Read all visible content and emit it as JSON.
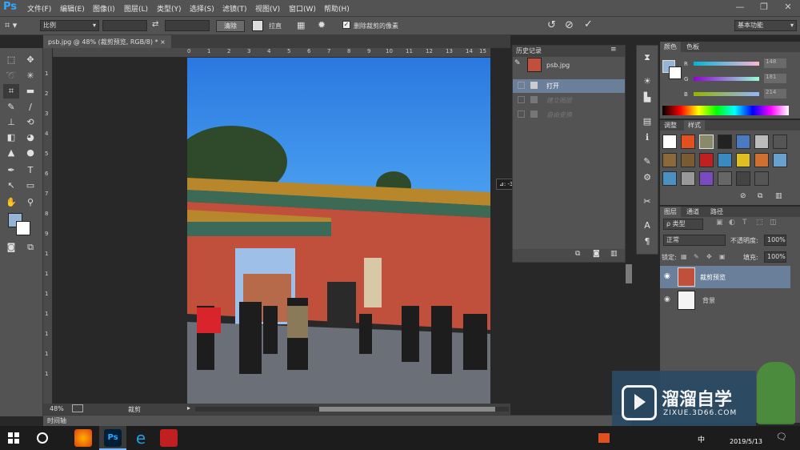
{
  "app": {
    "logo": "Ps"
  },
  "menu": [
    "文件(F)",
    "编辑(E)",
    "图像(I)",
    "图层(L)",
    "类型(Y)",
    "选择(S)",
    "滤镜(T)",
    "视图(V)",
    "窗口(W)",
    "帮助(H)"
  ],
  "window_controls": {
    "minimize": "—",
    "restore": "❐",
    "close": "✕"
  },
  "options": {
    "ratio_select": "比例",
    "swap_icon": "⇄",
    "clear_button": "清除",
    "straighten_label": "拉直",
    "delete_cropped_label": "删除裁剪的像素",
    "delete_cropped_checked": true,
    "workspace": "基本功能"
  },
  "document": {
    "tab_title": "psb.jpg @ 48% (裁剪预览, RGB/8) *",
    "tab_close": "×",
    "zoom": "48%",
    "status_tool": "裁剪",
    "rotation_tooltip": "⊿: -3.6°",
    "ruler_top": [
      "0",
      "1",
      "2",
      "3",
      "4",
      "5",
      "6",
      "7",
      "8",
      "9",
      "10",
      "11",
      "12",
      "13",
      "14",
      "15"
    ],
    "ruler_left": [
      "1",
      "2",
      "3",
      "4",
      "5",
      "6",
      "7",
      "8",
      "9",
      "1",
      "1",
      "1",
      "1",
      "1",
      "1",
      "1"
    ]
  },
  "timeline_label": "时间轴",
  "history": {
    "title": "历史记录",
    "snapshot": "psb.jpg",
    "items": [
      {
        "label": "打开",
        "active": true
      },
      {
        "label": "建立图层",
        "active": false
      },
      {
        "label": "自由变换",
        "active": false
      }
    ]
  },
  "color_panel": {
    "tabs": [
      "颜色",
      "色板"
    ],
    "r": 148,
    "g": 181,
    "b": 214,
    "r_label": "R",
    "g_label": "G",
    "b_label": "B",
    "fg": "#94b5d6"
  },
  "styles_panel": {
    "tabs": [
      "调整",
      "样式"
    ]
  },
  "layers_panel": {
    "tabs": [
      "图层",
      "通道",
      "路径"
    ],
    "kind": "ρ 类型",
    "blend_mode": "正常",
    "opacity_label": "不透明度:",
    "opacity": "100%",
    "lock_label": "锁定:",
    "fill_label": "填充:",
    "fill": "100%",
    "layers": [
      {
        "name": "裁剪预览",
        "selected": true
      },
      {
        "name": "背景",
        "selected": false
      }
    ]
  },
  "watermark": {
    "title": "溜溜自学",
    "url": "ZIXUE.3D66.COM"
  },
  "taskbar": {
    "date": "2019/5/13",
    "ime": "中"
  },
  "colors": {
    "accent": "#31a8ff",
    "panel": "#535353",
    "dark": "#282828",
    "selected": "#6a7f9a",
    "sky": "#2c7de4",
    "wall": "#c0503c"
  }
}
